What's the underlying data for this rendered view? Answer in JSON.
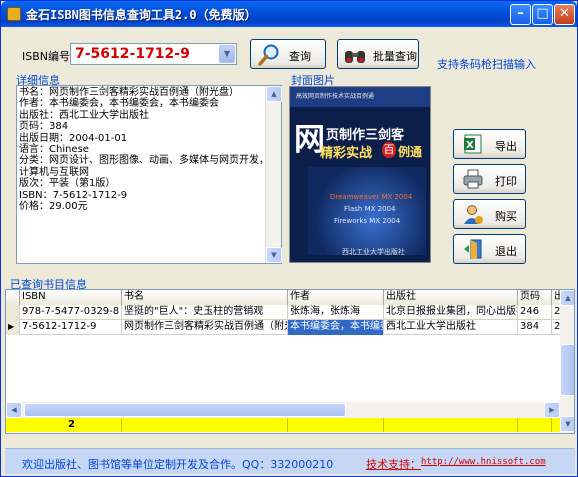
{
  "window": {
    "title": "金石ISBN图书信息查询工具2.0（免费版）"
  },
  "isbn": {
    "label": "ISBN编号：",
    "value": "7-5612-1712-9"
  },
  "buttons": {
    "query": "查询",
    "batch_query": "批量查询",
    "export": "导出",
    "print": "打印",
    "buy": "购买",
    "exit": "退出"
  },
  "scanner_note": "支持条码枪扫描输入",
  "details": {
    "group_label": "详细信息",
    "lines": [
      "书名：网页制作三剑客精彩实战百例通（附光盘）",
      "作者：本书编委会，本书编委会，本书编委会",
      "出版社：西北工业大学出版社",
      "页码：384",
      "出版日期：2004-01-01",
      "语言：Chinese",
      "分类：网页设计、图形图像、动画、多媒体与网页开发，",
      "计算机与互联网",
      "版次：平装（第1版）",
      "ISBN：7-5612-1712-9",
      "价格：29.00元"
    ]
  },
  "cover": {
    "group_label": "封面图片",
    "top_text": "高效网页制作技术实战百例通",
    "title_big": "网",
    "title_1": "页制作三剑客",
    "title_2": "精彩实战",
    "title_3": "百",
    "title_4": "例通",
    "badges": [
      "Dreamweaver MX 2004",
      "Flash MX 2004",
      "Fireworks MX 2004"
    ],
    "publisher": "西北工业大学出版社"
  },
  "grid": {
    "group_label": "已查询书目信息",
    "columns": [
      "ISBN",
      "书名",
      "作者",
      "出版社",
      "页码",
      "出"
    ],
    "rows": [
      {
        "marker": "",
        "isbn": "978-7-5477-0329-8",
        "title": "坚挺的\"巨人\"：史玉柱的营销观",
        "author": "张炼海，张炼海",
        "publisher": "北京日报报业集团，同心出版社",
        "pages": "246",
        "extra": "20"
      },
      {
        "marker": "▶",
        "isbn": "7-5612-1712-9",
        "title": "网页制作三剑客精彩实战百例通（附光",
        "author": "本书编委会，本书编委",
        "publisher": "西北工业大学出版社",
        "pages": "384",
        "extra": "20"
      }
    ],
    "count": "2"
  },
  "status": {
    "left": "欢迎出版社、图书馆等单位定制开发及合作。QQ：332000210",
    "right_label": "技术支持：",
    "right_url": "http://www.hnissoft.com"
  },
  "colors": {
    "accent": "#0046D5",
    "isbn_value": "#D40000",
    "selection": "#316AC5",
    "summary_row": "#FFFF00"
  }
}
